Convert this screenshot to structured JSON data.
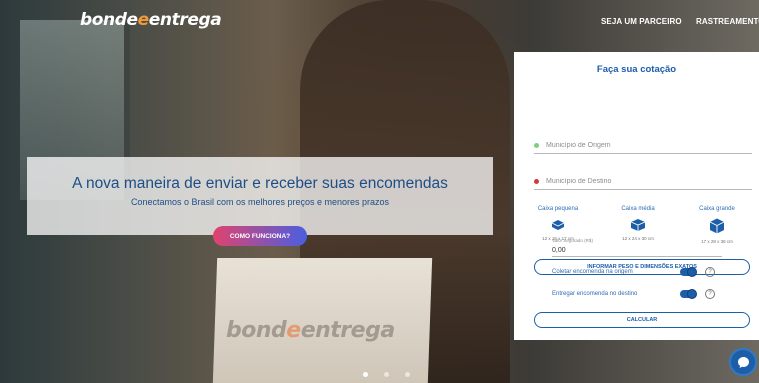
{
  "header": {
    "logo_prefix": "bonde",
    "logo_accent": "e",
    "logo_suffix": "entrega",
    "nav": [
      "SEJA UM PARCEIRO",
      "RASTREAMENTO"
    ]
  },
  "hero": {
    "headline": "A nova maneira de enviar e receber suas encomendas",
    "subline": "Conectamos o Brasil com os melhores preços e menores prazos",
    "cta": "COMO FUNCIONA?",
    "box_print_prefix": "bond",
    "box_print_accent": "e",
    "box_print_suffix": "entrega",
    "carousel_slides": 3,
    "carousel_active": 1
  },
  "quote": {
    "title": "Faça sua cotação",
    "origem_placeholder": "Município de Origem",
    "destino_placeholder": "Município de Destino",
    "boxes": [
      {
        "name": "Caixa pequena",
        "dims": "12 x 16 x 17 cm",
        "icon": "small-box-icon"
      },
      {
        "name": "Caixa média",
        "dims": "12 x 24 x 30 cm",
        "icon": "medium-box-icon"
      },
      {
        "name": "Caixa grande",
        "dims": "17 x 28 x 36 cm",
        "icon": "large-box-icon"
      }
    ],
    "dims_button": "INFORMAR PESO E DIMENSÕES EXATOS",
    "valor_label": "Valor Segurado (R$)",
    "valor_value": "0,00",
    "coletar_label": "Coletar encomenda na origem",
    "coletar_on": true,
    "entregar_label": "Entregar encomenda no destino",
    "entregar_on": true,
    "help_glyph": "?",
    "calc_button": "CALCULAR"
  },
  "colors": {
    "brand_blue": "#1d5ea8",
    "accent_orange": "#f29a3a",
    "origem_dot": "#7ed07e",
    "destino_dot": "#d23a3a"
  }
}
